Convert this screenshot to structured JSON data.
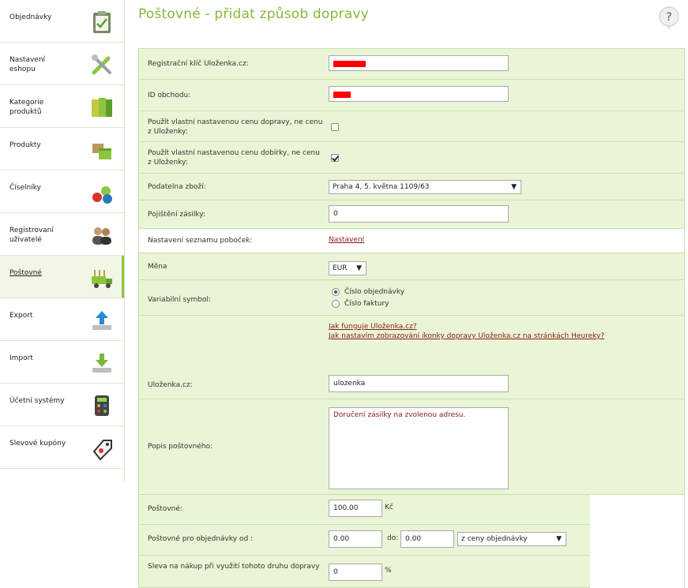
{
  "sidebar": {
    "items": [
      {
        "label": "Objednávky",
        "icon": "clipboard-icon",
        "active": false
      },
      {
        "label": "Nastavení eshopu",
        "icon": "tools-icon",
        "active": false
      },
      {
        "label": "Kategorie produktů",
        "icon": "categories-icon",
        "active": false
      },
      {
        "label": "Produkty",
        "icon": "boxes-icon",
        "active": false
      },
      {
        "label": "Číselníky",
        "icon": "numbers-icon",
        "active": false
      },
      {
        "label": "Registrovaní uživatelé",
        "icon": "users-icon",
        "active": false
      },
      {
        "label": "Poštovné",
        "icon": "truck-icon",
        "active": true
      },
      {
        "label": "Export",
        "icon": "upload-icon",
        "active": false
      },
      {
        "label": "Import",
        "icon": "download-icon",
        "active": false
      },
      {
        "label": "Účetní systémy",
        "icon": "calculator-icon",
        "active": false
      },
      {
        "label": "Slevové kupóny",
        "icon": "coupon-icon",
        "active": false
      }
    ]
  },
  "page": {
    "title": "Poštovné - přidat způsob dopravy",
    "help_symbol": "?"
  },
  "form": {
    "registration_key": {
      "label": "Registrační klíč Uloženka.cz:"
    },
    "shop_id": {
      "label": "ID obchodu:"
    },
    "own_shipping_price": {
      "label": "Použít vlastní nastavenou cenu dopravy, ne cenu z Uloženky:",
      "checked": false
    },
    "own_cod_price": {
      "label": "Použít vlastní nastavenou cenu dobírky, ne cenu z Uloženky:",
      "checked": true
    },
    "dispatch_office": {
      "label": "Podatelna zboží:",
      "value": "Praha 4, 5. května 1109/63"
    },
    "insurance": {
      "label": "Pojištění zásilky:",
      "value": "0"
    },
    "branch_list": {
      "label": "Nastavení seznamu poboček:",
      "link": "Nastavení"
    },
    "currency": {
      "label": "Měna",
      "value": "EUR"
    },
    "variable_symbol": {
      "label": "Variabilní symbol:",
      "options": [
        "Číslo objednávky",
        "Číslo faktury"
      ],
      "selected": 0
    },
    "ulozenka": {
      "label": "Uloženka.cz:",
      "value": "ulozenka",
      "links": [
        "Jak funguje Uloženka.cz?",
        "Jak nastavím zobrazování ikonky dopravy Uloženka.cz na stránkách Heureky?"
      ]
    },
    "description": {
      "label": "Popis poštovného:",
      "value": "Doručení zásilky na zvolenou adresu."
    },
    "shipping_price": {
      "label": "Poštovné:",
      "value": "100.00",
      "unit": "Kč"
    },
    "shipping_for_orders": {
      "label": "Poštovné pro objednávky od :",
      "from": "0.00",
      "to_label": "do:",
      "to": "0.00",
      "basis": "z ceny objednávky"
    },
    "discount": {
      "label": "Sleva na nákup při využití tohoto druhu dopravy",
      "value": "0",
      "unit": "%"
    }
  },
  "colors": {
    "accent": "#86b83c",
    "row_bg": "#e9f5d6",
    "border": "#c8dfae",
    "link": "#8b1a1a",
    "redaction": "#ff0000"
  }
}
